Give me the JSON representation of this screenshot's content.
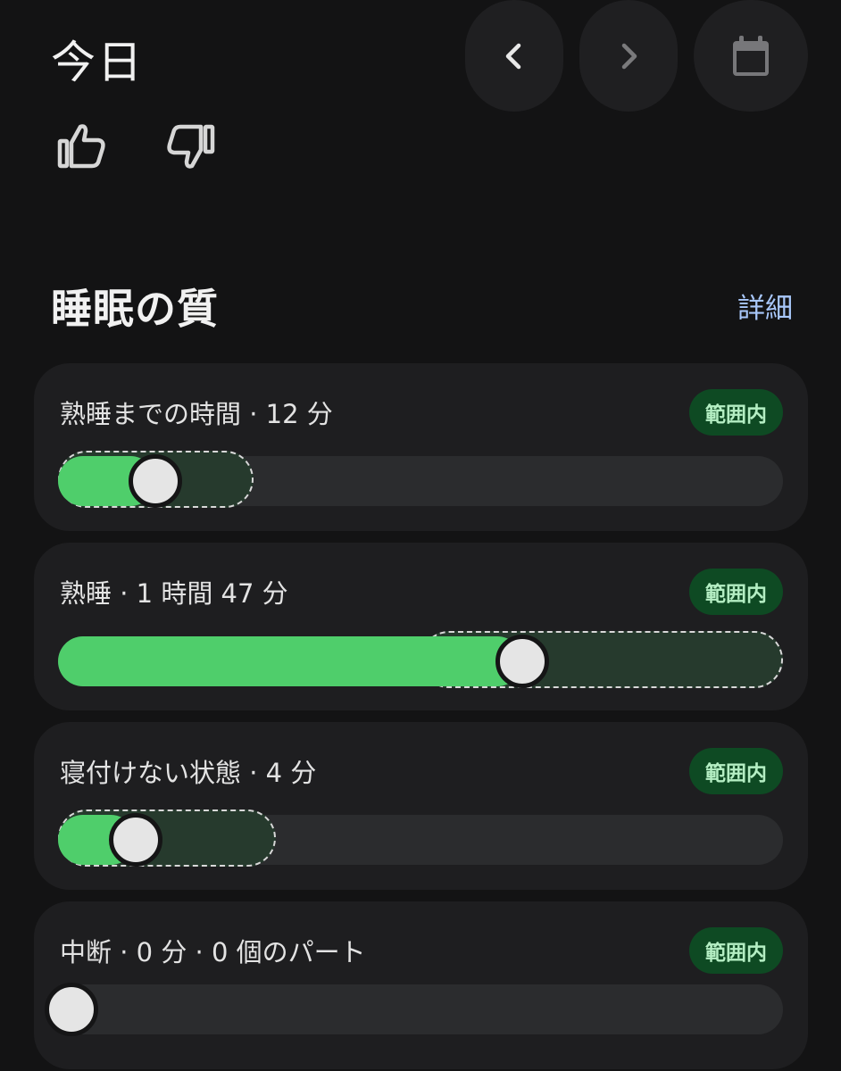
{
  "header": {
    "date_title": "今日",
    "prev_icon": "chevron-left-icon",
    "next_icon": "chevron-right-icon",
    "calendar_icon": "calendar-icon",
    "like_icon": "thumb-up-icon",
    "dislike_icon": "thumb-down-icon"
  },
  "section": {
    "title": "睡眠の質",
    "details_link": "詳細"
  },
  "metrics": [
    {
      "label": "熟睡までの時間 · 12 分",
      "badge": "範囲内",
      "value_fraction": 0.134,
      "range": [
        0,
        0.27
      ]
    },
    {
      "label": "熟睡 · 1 時間 47 分",
      "badge": "範囲内",
      "value_fraction": 0.64,
      "range": [
        0.5,
        1.0
      ]
    },
    {
      "label": "寝付けない状態 · 4 分",
      "badge": "範囲内",
      "value_fraction": 0.107,
      "range": [
        0,
        0.3
      ]
    },
    {
      "label": "中断 · 0 分 · 0 個のパート",
      "badge": "範囲内",
      "value_fraction": 0,
      "range": null
    }
  ],
  "colors": {
    "accent_green": "#4fce6b",
    "badge_bg": "#0e4a23",
    "badge_text": "#b4eec3",
    "link": "#a8c7fa",
    "background": "#131314",
    "card": "#1e1e20"
  }
}
